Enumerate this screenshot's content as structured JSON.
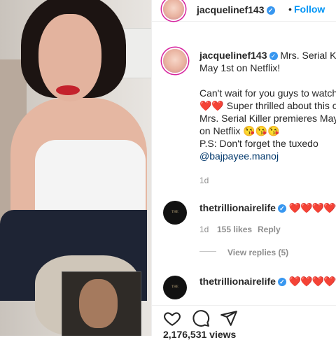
{
  "post": {
    "username": "jacquelinef143",
    "follow_label": "Follow",
    "separator": "•",
    "caption_user": "jacquelinef143",
    "caption_lines": [
      "Mrs. Serial Kil",
      "May 1st on Netflix!",
      "",
      "Can't wait for you guys to watch",
      "❤️❤️ Super thrilled about this on",
      "Mrs. Serial Killer premieres May",
      "on Netflix 😘😘😘",
      "P.S: Don't forget the tuxedo"
    ],
    "mention": "@bajpayee.manoj",
    "caption_age": "1d",
    "likes_partial": "2,176,531 views"
  },
  "comments": [
    {
      "username": "thetrillionairelife",
      "text": "❤️❤️❤️❤️❤️",
      "avatar_text": "THE TRILLIONAIRE LIFE",
      "age": "1d",
      "likes": "155 likes",
      "reply_label": "Reply",
      "view_replies": "View replies (5)"
    },
    {
      "username": "thetrillionairelife",
      "text": "❤️❤️❤️❤️❤️",
      "avatar_text": "THE TRILLIONAIRE LIFE"
    }
  ],
  "icons": {
    "like": "heart-icon",
    "comment": "comment-icon",
    "share": "send-icon",
    "verified": "verified-badge-icon"
  },
  "colors": {
    "link": "#0095f6",
    "verified": "#3897f0",
    "heart": "#ed1c3a"
  }
}
